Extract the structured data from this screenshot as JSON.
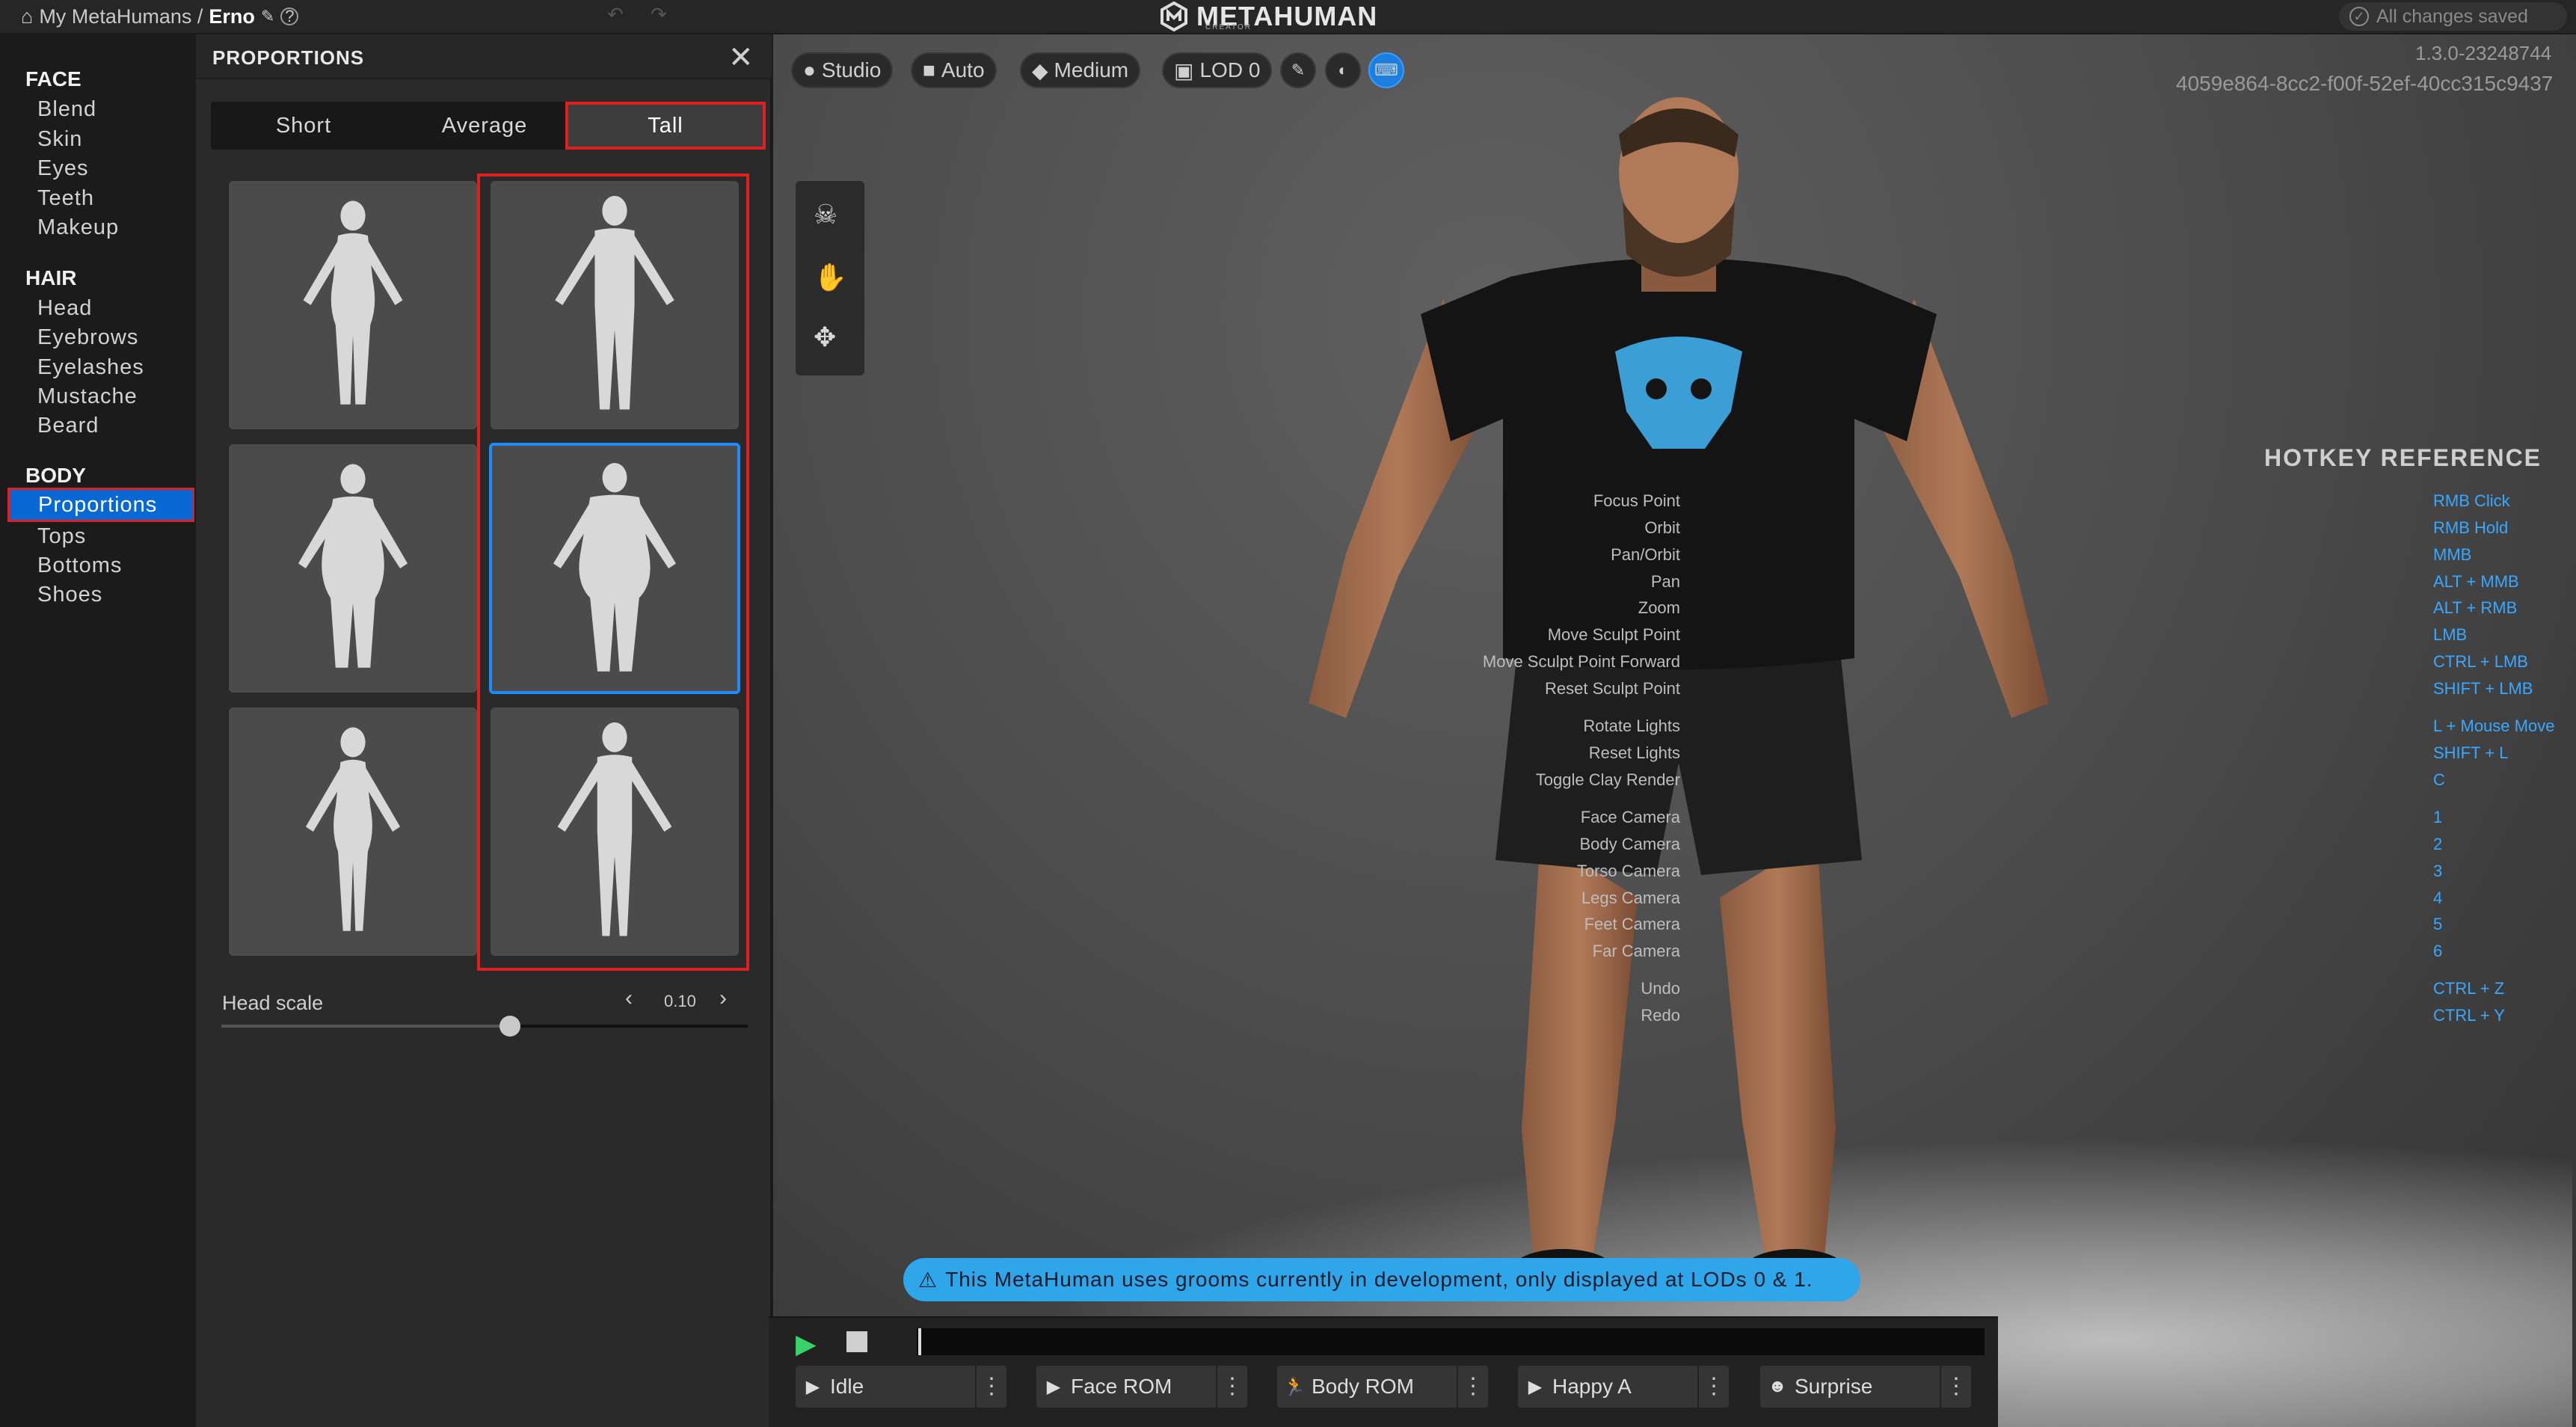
{
  "breadcrumb": {
    "root": "My MetaHumans /",
    "current": "Erno"
  },
  "brand": {
    "name": "METAHUMAN",
    "sub": "CREATOR"
  },
  "status": {
    "saved": "All changes saved"
  },
  "nav": {
    "face": {
      "title": "FACE",
      "items": [
        "Blend",
        "Skin",
        "Eyes",
        "Teeth",
        "Makeup"
      ]
    },
    "hair": {
      "title": "HAIR",
      "items": [
        "Head",
        "Eyebrows",
        "Eyelashes",
        "Mustache",
        "Beard"
      ]
    },
    "body": {
      "title": "BODY",
      "items": [
        "Proportions",
        "Tops",
        "Bottoms",
        "Shoes"
      ]
    }
  },
  "panel": {
    "title": "PROPORTIONS",
    "tabs": [
      "Short",
      "Average",
      "Tall"
    ],
    "selected_tab": "Tall",
    "head_scale": {
      "label": "Head scale",
      "value": "0.10",
      "fraction": 0.55
    }
  },
  "viewport": {
    "buttons": {
      "lighting": "Studio",
      "camera": "Auto",
      "quality": "Medium",
      "lod": "LOD 0"
    },
    "version": "1.3.0-23248744",
    "id": "4059e864-8cc2-f00f-52ef-40cc315c9437"
  },
  "hotkeys": {
    "title": "HOTKEY REFERENCE",
    "items": [
      {
        "k": "Focus Point",
        "v": "RMB Click"
      },
      {
        "k": "Orbit",
        "v": "RMB Hold"
      },
      {
        "k": "Pan/Orbit",
        "v": "MMB"
      },
      {
        "k": "Pan",
        "v": "ALT + MMB"
      },
      {
        "k": "Zoom",
        "v": "ALT + RMB"
      },
      {
        "k": "Move Sculpt Point",
        "v": "LMB"
      },
      {
        "k": "Move Sculpt Point Forward",
        "v": "CTRL + LMB"
      },
      {
        "k": "Reset Sculpt Point",
        "v": "SHIFT + LMB"
      },
      {
        "k": "Rotate Lights",
        "v": "L + Mouse Move"
      },
      {
        "k": "Reset Lights",
        "v": "SHIFT + L"
      },
      {
        "k": "Toggle Clay Render",
        "v": "C"
      },
      {
        "k": "Face Camera",
        "v": "1"
      },
      {
        "k": "Body Camera",
        "v": "2"
      },
      {
        "k": "Torso Camera",
        "v": "3"
      },
      {
        "k": "Legs Camera",
        "v": "4"
      },
      {
        "k": "Feet Camera",
        "v": "5"
      },
      {
        "k": "Far Camera",
        "v": "6"
      },
      {
        "k": "Undo",
        "v": "CTRL + Z"
      },
      {
        "k": "Redo",
        "v": "CTRL + Y"
      }
    ]
  },
  "banner": {
    "text": "This MetaHuman uses grooms currently in development, only displayed at LODs 0 & 1."
  },
  "animations": [
    "Idle",
    "Face ROM",
    "Body ROM",
    "Happy A",
    "Surprise"
  ]
}
